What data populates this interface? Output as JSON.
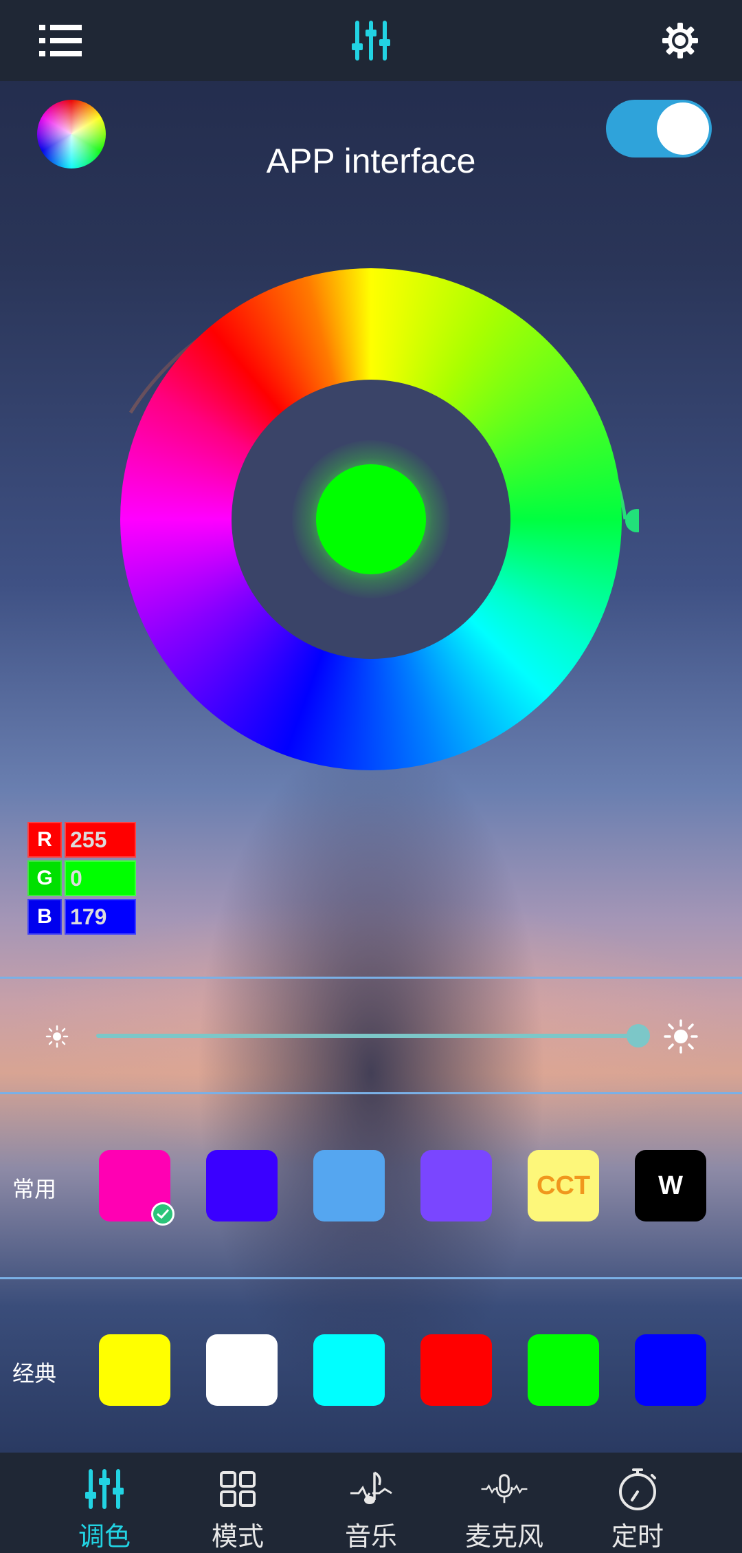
{
  "header": {
    "menu_icon": "menu-list-icon",
    "center_icon": "equalizer-icon",
    "settings_icon": "gear-icon"
  },
  "power_toggle": {
    "state": "on",
    "color": "#2fa3da"
  },
  "title": "APP interface",
  "color_wheel": {
    "selected_color": "#00ff00"
  },
  "rgb": {
    "r_label": "R",
    "r_value": "255",
    "g_label": "G",
    "g_value": "0",
    "b_label": "B",
    "b_value": "179"
  },
  "brightness": {
    "level_fraction": 0.98,
    "low_icon": "sun-small-icon",
    "high_icon": "sun-large-icon"
  },
  "common": {
    "label": "常用",
    "swatches": [
      {
        "color": "#ff00b3",
        "text": "",
        "selected": true
      },
      {
        "color": "#3a00ff",
        "text": ""
      },
      {
        "color": "#55a6f0",
        "text": ""
      },
      {
        "color": "#7a46ff",
        "text": ""
      },
      {
        "color": "#fdf77a",
        "text": "CCT",
        "text_color": "#f0971d"
      },
      {
        "color": "#000000",
        "text": "W",
        "text_color": "#ffffff"
      }
    ]
  },
  "classic": {
    "label": "经典",
    "swatches": [
      {
        "color": "#ffff00"
      },
      {
        "color": "#ffffff"
      },
      {
        "color": "#00ffff"
      },
      {
        "color": "#ff0000"
      },
      {
        "color": "#00ff00"
      },
      {
        "color": "#0000ff"
      }
    ]
  },
  "tabs": [
    {
      "label": "调色",
      "icon": "equalizer-icon",
      "active": true
    },
    {
      "label": "模式",
      "icon": "grid-icon",
      "active": false
    },
    {
      "label": "音乐",
      "icon": "music-note-icon",
      "active": false
    },
    {
      "label": "麦克风",
      "icon": "microphone-icon",
      "active": false
    },
    {
      "label": "定时",
      "icon": "stopwatch-icon",
      "active": false
    }
  ]
}
